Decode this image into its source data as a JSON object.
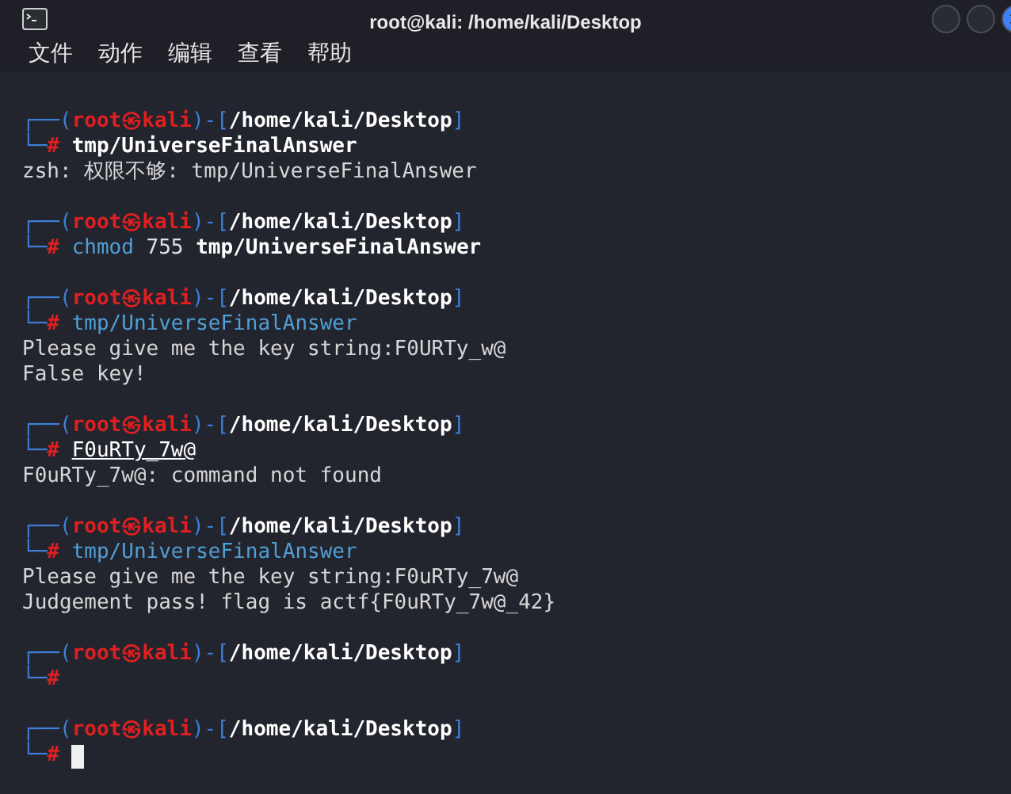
{
  "window": {
    "title": "root@kali: /home/kali/Desktop"
  },
  "menu": [
    "文件",
    "动作",
    "编辑",
    "查看",
    "帮助"
  ],
  "blocks": [
    {
      "prompt": {
        "open": "┌──(",
        "user": "root",
        "at": "㉿",
        "host": "kali",
        "mid": ")-[",
        "path": "/home/kali/Desktop",
        "close": "]",
        "corner": "└─",
        "hash": "#"
      },
      "command": [
        {
          "text": "tmp/UniverseFinalAnswer",
          "kind": "bold"
        }
      ],
      "output": [
        "zsh: 权限不够: tmp/UniverseFinalAnswer"
      ],
      "cursor": false
    },
    {
      "prompt": {
        "open": "┌──(",
        "user": "root",
        "at": "㉿",
        "host": "kali",
        "mid": ")-[",
        "path": "/home/kali/Desktop",
        "close": "]",
        "corner": "└─",
        "hash": "#"
      },
      "command": [
        {
          "text": "chmod",
          "kind": "builtin"
        },
        {
          "text": " 755 ",
          "kind": "plain"
        },
        {
          "text": "tmp/UniverseFinalAnswer",
          "kind": "bold"
        }
      ],
      "cursor": false
    },
    {
      "prompt": {
        "open": "┌──(",
        "user": "root",
        "at": "㉿",
        "host": "kali",
        "mid": ")-[",
        "path": "/home/kali/Desktop",
        "close": "]",
        "corner": "└─",
        "hash": "#"
      },
      "command": [
        {
          "text": "tmp/UniverseFinalAnswer",
          "kind": "builtin"
        }
      ],
      "output": [
        "Please give me the key string:F0URTy_w@",
        "False key!"
      ],
      "cursor": false
    },
    {
      "prompt": {
        "open": "┌──(",
        "user": "root",
        "at": "㉿",
        "host": "kali",
        "mid": ")-[",
        "path": "/home/kali/Desktop",
        "close": "]",
        "corner": "└─",
        "hash": "#"
      },
      "command": [
        {
          "text": "F0uRTy_7w@",
          "kind": "underline"
        }
      ],
      "output": [
        "F0uRTy_7w@: command not found"
      ],
      "cursor": false
    },
    {
      "prompt": {
        "open": "┌──(",
        "user": "root",
        "at": "㉿",
        "host": "kali",
        "mid": ")-[",
        "path": "/home/kali/Desktop",
        "close": "]",
        "corner": "└─",
        "hash": "#"
      },
      "command": [
        {
          "text": "tmp/UniverseFinalAnswer",
          "kind": "builtin"
        }
      ],
      "output": [
        "Please give me the key string:F0uRTy_7w@",
        "Judgement pass! flag is actf{F0uRTy_7w@_42}"
      ],
      "cursor": false
    },
    {
      "prompt": {
        "open": "┌──(",
        "user": "root",
        "at": "㉿",
        "host": "kali",
        "mid": ")-[",
        "path": "/home/kali/Desktop",
        "close": "]",
        "corner": "└─",
        "hash": "#"
      },
      "cursor": false
    },
    {
      "prompt": {
        "open": "┌──(",
        "user": "root",
        "at": "㉿",
        "host": "kali",
        "mid": ")-[",
        "path": "/home/kali/Desktop",
        "close": "]",
        "corner": "└─",
        "hash": "#"
      },
      "cursor": true
    }
  ]
}
